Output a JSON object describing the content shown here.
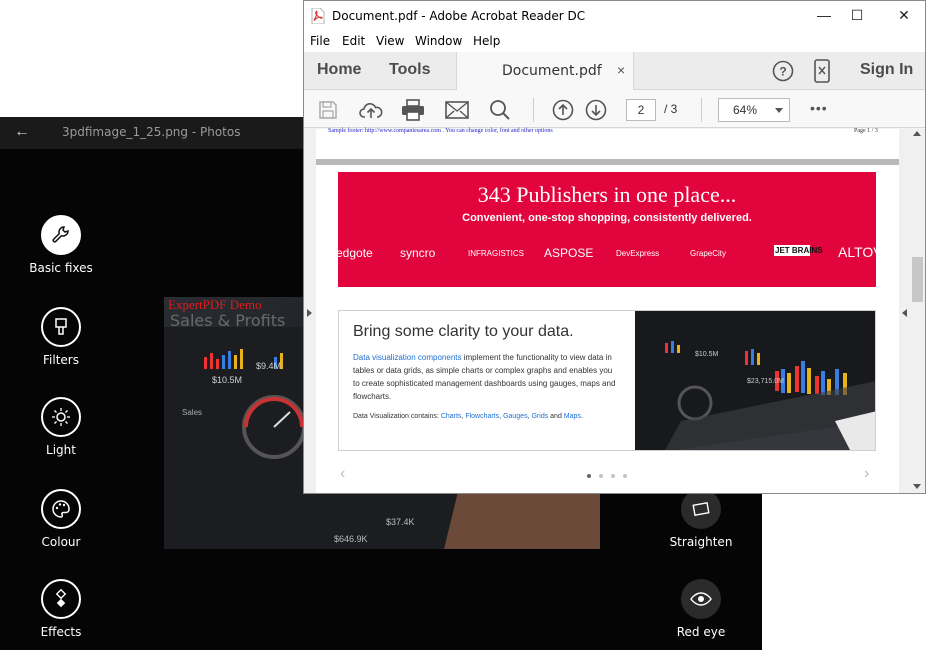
{
  "photos": {
    "back": "←",
    "title": "3pdfimage_1_25.png - Photos",
    "tools_left": [
      {
        "label": "Basic fixes",
        "icon": "wrench-icon"
      },
      {
        "label": "Filters",
        "icon": "brush-icon"
      },
      {
        "label": "Light",
        "icon": "sun-icon"
      },
      {
        "label": "Colour",
        "icon": "palette-icon"
      },
      {
        "label": "Effects",
        "icon": "effects-icon"
      }
    ],
    "tools_right": [
      {
        "label": "Straighten",
        "icon": "straighten-icon"
      },
      {
        "label": "Red eye",
        "icon": "eye-icon"
      }
    ],
    "preview": {
      "watermark": "ExpertPDF Demo",
      "heading": "Sales & Profits"
    }
  },
  "acrobat": {
    "title": "Document.pdf - Adobe Acrobat Reader DC",
    "window_controls": [
      "—",
      "☐",
      "✕"
    ],
    "menu": [
      "File",
      "Edit",
      "View",
      "Window",
      "Help"
    ],
    "tabs": {
      "home": "Home",
      "tools": "Tools",
      "document": "Document.pdf",
      "close": "×",
      "sign_in": "Sign In"
    },
    "toolbar": {
      "page_current": "2",
      "page_total": "/ 3",
      "zoom": "64%",
      "more": "•••"
    },
    "page": {
      "header_text": "Sample footer: http://www.companiesarea.com . You can change color, font and other options",
      "page_number": "Page 1 / 3",
      "banner": {
        "title": "343 Publishers in one place...",
        "subtitle": "Convenient, one-stop shopping, consistently delivered.",
        "logos": [
          "edgote",
          "syncro",
          "INFRAGISTICS",
          "ASPOSE",
          "DevExpress",
          "GrapeCity",
          "JET BRAINS",
          "ALTOV"
        ]
      },
      "card": {
        "heading": "Bring some clarity to your data.",
        "body_link": "Data visualization components",
        "body_text": " implement the functionality to view data in tables or data grids, as simple charts or complex graphs and enables you to create sophisticated management dashboards using gauges, maps and flowcharts.",
        "contains_label": "Data Visualization contains: ",
        "contains_items": [
          "Charts",
          "Flowcharts",
          "Gauges",
          "Grids",
          "Maps"
        ]
      },
      "carousel": {
        "prev": "‹",
        "next": "›",
        "dots": 4,
        "active": 0
      }
    }
  },
  "colors": {
    "banner_red": "#e2043c",
    "link_blue": "#1f6fd1",
    "photos_bg": "#050505"
  }
}
